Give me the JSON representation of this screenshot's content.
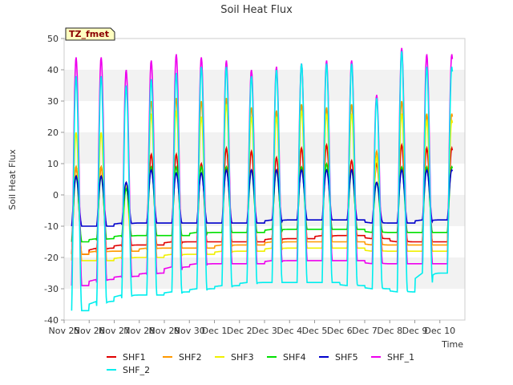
{
  "chart_data": {
    "type": "line",
    "title": "Soil Heat Flux",
    "xlabel": "Time",
    "ylabel": "Soil Heat Flux",
    "site_label": "TZ_fmet",
    "ylim": [
      -40,
      50
    ],
    "yticks": [
      -40,
      -30,
      -20,
      -10,
      0,
      10,
      20,
      30,
      40,
      50
    ],
    "xlim_days": [
      0,
      16
    ],
    "xtick_labels": [
      "Nov 25",
      "Nov 26",
      "Nov 27",
      "Nov 28",
      "Nov 29",
      "Nov 30",
      "Dec 1",
      "Dec 2",
      "Dec 3",
      "Dec 4",
      "Dec 5",
      "Dec 6",
      "Dec 7",
      "Dec 8",
      "Dec 9",
      "Dec 10"
    ],
    "grid": "horizontal bands",
    "legend_position": "bottom",
    "data_start_day": 0.3,
    "data_end_day": 15.5,
    "series": [
      {
        "name": "SHF1",
        "color": "#e00000",
        "peaks": [
          9,
          4,
          13,
          13,
          10,
          15,
          14,
          12,
          15,
          16,
          11,
          10,
          16,
          15
        ],
        "troughs": [
          -19,
          -17,
          -16,
          -16,
          -15,
          -15,
          -15,
          -15,
          -14,
          -14,
          -13,
          -13,
          -14,
          -15,
          -15
        ]
      },
      {
        "name": "SHF2",
        "color": "#ff9900",
        "peaks": [
          9,
          3,
          30,
          31,
          30,
          31,
          28,
          27,
          29,
          28,
          29,
          14,
          30,
          26
        ],
        "troughs": [
          -19,
          -18,
          -18,
          -17,
          -17,
          -17,
          -16,
          -16,
          -15,
          -15,
          -15,
          -15,
          -16,
          -16,
          -16
        ]
      },
      {
        "name": "SHF3",
        "color": "#f0f000",
        "peaks": [
          20,
          3,
          26,
          27,
          25,
          29,
          25,
          25,
          27,
          26,
          26,
          12,
          26,
          24
        ],
        "troughs": [
          -21,
          -21,
          -20,
          -20,
          -19,
          -19,
          -18,
          -18,
          -17,
          -17,
          -17,
          -17,
          -18,
          -18,
          -18
        ]
      },
      {
        "name": "SHF4",
        "color": "#00e000",
        "peaks": [
          6,
          2,
          9,
          9,
          9,
          9,
          8,
          8,
          9,
          10,
          8,
          4,
          9,
          9
        ],
        "troughs": [
          -15,
          -14,
          -13,
          -13,
          -13,
          -12,
          -12,
          -12,
          -11,
          -11,
          -11,
          -11,
          -12,
          -12,
          -12
        ]
      },
      {
        "name": "SHF5",
        "color": "#0000cc",
        "peaks": [
          6,
          4,
          8,
          7,
          7,
          8,
          8,
          8,
          8,
          8,
          8,
          4,
          8,
          8
        ],
        "troughs": [
          -10,
          -10,
          -9,
          -9,
          -9,
          -9,
          -9,
          -9,
          -8,
          -8,
          -8,
          -8,
          -9,
          -9,
          -8
        ]
      },
      {
        "name": "SHF_1",
        "color": "#ee00ee",
        "peaks": [
          44,
          40,
          43,
          45,
          44,
          43,
          40,
          41,
          42,
          43,
          43,
          32,
          47,
          45
        ],
        "troughs": [
          -29,
          -27,
          -26,
          -25,
          -23,
          -22,
          -22,
          -22,
          -21,
          -21,
          -21,
          -21,
          -22,
          -22,
          -22
        ]
      },
      {
        "name": "SHF_2",
        "color": "#00eeee",
        "peaks": [
          38,
          35,
          37,
          39,
          41,
          41,
          38,
          40,
          42,
          42,
          42,
          31,
          46,
          41
        ],
        "troughs": [
          -37,
          -34,
          -32,
          -32,
          -31,
          -30,
          -29,
          -28,
          -28,
          -28,
          -28,
          -29,
          -30,
          -31,
          -25
        ]
      }
    ]
  }
}
